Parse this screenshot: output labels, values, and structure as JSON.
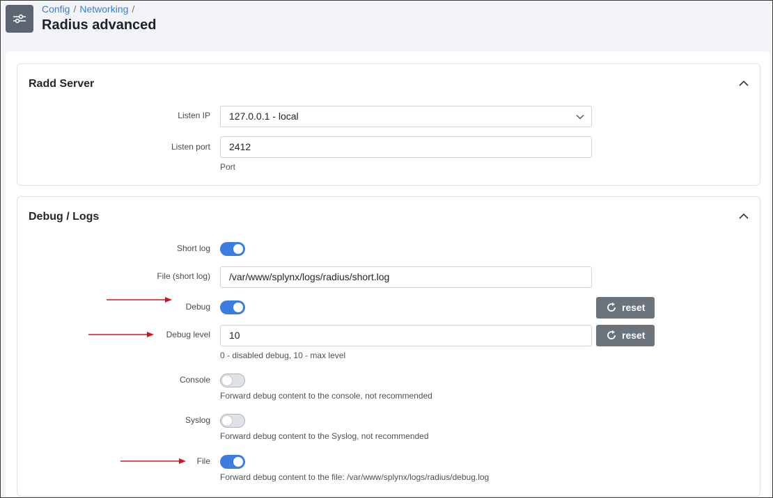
{
  "breadcrumb": {
    "item1": "Config",
    "item2": "Networking",
    "sep": "/"
  },
  "page": {
    "title": "Radius advanced",
    "icon": "sliders-icon"
  },
  "radd_server": {
    "title": "Radd Server",
    "listen_ip_label": "Listen IP",
    "listen_ip_value": "127.0.0.1 - local",
    "listen_port_label": "Listen port",
    "listen_port_value": "2412",
    "listen_port_help": "Port"
  },
  "debug_logs": {
    "title": "Debug / Logs",
    "short_log_label": "Short log",
    "short_log_on": true,
    "file_short_label": "File (short log)",
    "file_short_value": "/var/www/splynx/logs/radius/short.log",
    "debug_label": "Debug",
    "debug_on": true,
    "reset_label": "reset",
    "debug_level_label": "Debug level",
    "debug_level_value": "10",
    "debug_level_help": "0 - disabled debug, 10 - max level",
    "console_label": "Console",
    "console_on": false,
    "console_help": "Forward debug content to the console, not recommended",
    "syslog_label": "Syslog",
    "syslog_on": false,
    "syslog_help": "Forward debug content to the Syslog, not recommended",
    "file_label": "File",
    "file_on": true,
    "file_help": "Forward debug content to the file: /var/www/splynx/logs/radius/debug.log"
  },
  "colors": {
    "accent": "#3b7de0",
    "annotation_arrow": "#d0161b",
    "reset_button": "#6b737b"
  }
}
